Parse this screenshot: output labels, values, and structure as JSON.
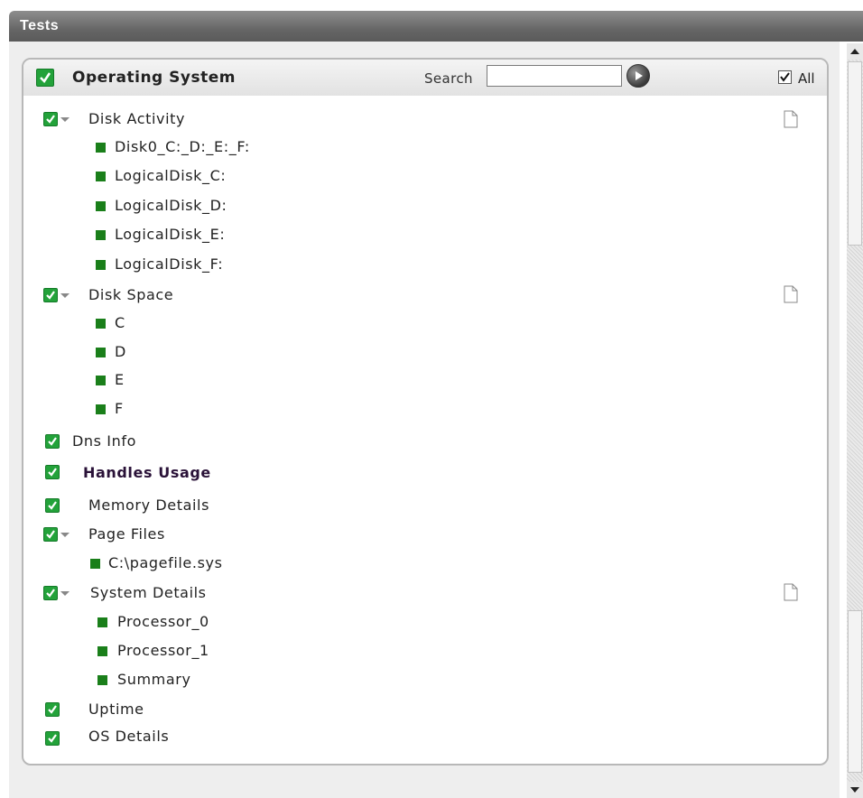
{
  "header": {
    "title": "Tests"
  },
  "panel": {
    "title": "Operating System",
    "search_label": "Search",
    "search_value": "",
    "all_label": "All"
  },
  "tests": [
    {
      "label": "Disk Activity",
      "expanded": true,
      "children": [
        "Disk0_C:_D:_E:_F:",
        "LogicalDisk_C:",
        "LogicalDisk_D:",
        "LogicalDisk_E:",
        "LogicalDisk_F:"
      ]
    },
    {
      "label": "Disk Space",
      "expanded": true,
      "children": [
        "C",
        "D",
        "E",
        "F"
      ]
    },
    {
      "label": "Dns Info"
    },
    {
      "label": "Handles Usage"
    },
    {
      "label": "Memory Details"
    },
    {
      "label": "Page Files",
      "expanded": true,
      "children": [
        "C:\\pagefile.sys"
      ]
    },
    {
      "label": "System Details",
      "expanded": true,
      "children": [
        "Processor_0",
        "Processor_1",
        "Summary"
      ]
    },
    {
      "label": "Uptime"
    },
    {
      "label": "OS Details"
    }
  ],
  "colors": {
    "check_green": "#23a23a",
    "leaf_green": "#1a7f1a",
    "header_gray": "#6e6e6e"
  }
}
